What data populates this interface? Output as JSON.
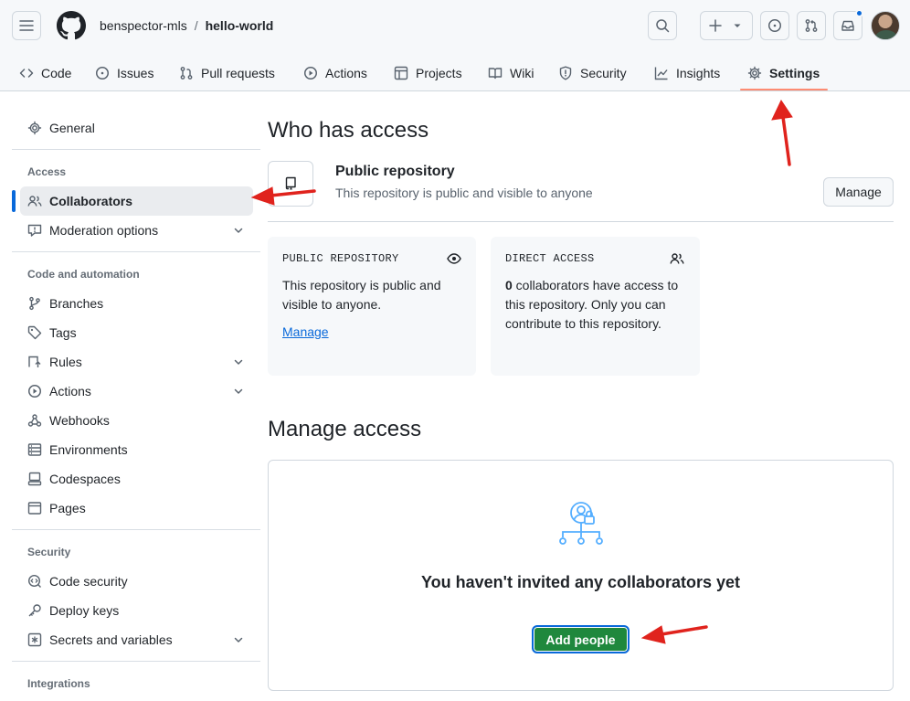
{
  "header": {
    "owner": "benspector-mls",
    "separator": "/",
    "repo": "hello-world"
  },
  "tabs": [
    {
      "label": "Code",
      "icon": "code-icon"
    },
    {
      "label": "Issues",
      "icon": "issue-icon"
    },
    {
      "label": "Pull requests",
      "icon": "pull-request-icon"
    },
    {
      "label": "Actions",
      "icon": "play-icon"
    },
    {
      "label": "Projects",
      "icon": "table-icon"
    },
    {
      "label": "Wiki",
      "icon": "book-icon"
    },
    {
      "label": "Security",
      "icon": "shield-icon"
    },
    {
      "label": "Insights",
      "icon": "graph-icon"
    },
    {
      "label": "Settings",
      "icon": "gear-icon",
      "active": true
    }
  ],
  "sidebar": {
    "general": "General",
    "sections": [
      {
        "heading": "Access",
        "items": [
          {
            "label": "Collaborators",
            "icon": "people-icon",
            "selected": true
          },
          {
            "label": "Moderation options",
            "icon": "report-icon",
            "expandable": true
          }
        ]
      },
      {
        "heading": "Code and automation",
        "items": [
          {
            "label": "Branches",
            "icon": "branch-icon"
          },
          {
            "label": "Tags",
            "icon": "tag-icon"
          },
          {
            "label": "Rules",
            "icon": "rules-icon",
            "expandable": true
          },
          {
            "label": "Actions",
            "icon": "play-icon",
            "expandable": true
          },
          {
            "label": "Webhooks",
            "icon": "webhook-icon"
          },
          {
            "label": "Environments",
            "icon": "server-icon"
          },
          {
            "label": "Codespaces",
            "icon": "codespaces-icon"
          },
          {
            "label": "Pages",
            "icon": "browser-icon"
          }
        ]
      },
      {
        "heading": "Security",
        "items": [
          {
            "label": "Code security",
            "icon": "codescan-icon"
          },
          {
            "label": "Deploy keys",
            "icon": "key-icon"
          },
          {
            "label": "Secrets and variables",
            "icon": "asterisk-icon",
            "expandable": true
          }
        ]
      },
      {
        "heading": "Integrations",
        "items": []
      }
    ]
  },
  "main": {
    "who_title": "Who has access",
    "public_title": "Public repository",
    "public_sub": "This repository is public and visible to anyone",
    "manage_button": "Manage",
    "card_public": {
      "label": "PUBLIC REPOSITORY",
      "body": "This repository is public and visible to anyone.",
      "link": "Manage"
    },
    "card_direct": {
      "label": "DIRECT ACCESS",
      "count": "0",
      "body": " collaborators have access to this repository. Only you can contribute to this repository."
    },
    "manage_access_title": "Manage access",
    "empty_title": "You haven't invited any collaborators yet",
    "add_people_button": "Add people"
  },
  "colors": {
    "accent_blue": "#0969da",
    "add_button_green": "#1f883d",
    "tab_underline": "#fd8c73",
    "annotation_red": "#e0231d"
  }
}
